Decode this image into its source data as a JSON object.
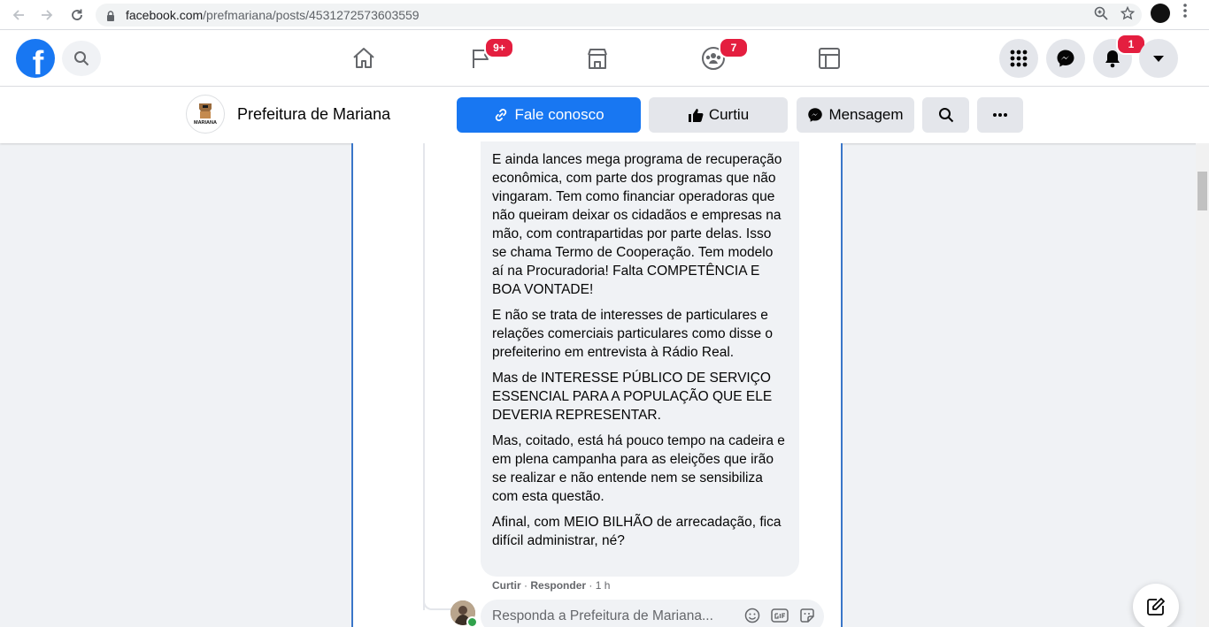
{
  "browser": {
    "url_host": "facebook.com",
    "url_path": "/prefmariana/posts/4531272573603559"
  },
  "fb_nav": {
    "logo_letter": "f",
    "pages_badge": "9+",
    "groups_badge": "7",
    "notifications_badge": "1"
  },
  "page_header": {
    "avatar_text": "MARIANA",
    "page_name": "Prefeitura de Mariana",
    "contact_label": "Fale conosco",
    "liked_label": "Curtiu",
    "message_label": "Mensagem"
  },
  "comment": {
    "paragraphs": [
      "E ainda lances mega programa de recuperação econômica, com parte dos programas que não vingaram. Tem como financiar operadoras que não queiram deixar os cidadãos e empresas na mão, com contrapartidas por parte delas. Isso se chama Termo de Cooperação. Tem modelo aí na Procuradoria! Falta COMPETÊNCIA E BOA VONTADE!",
      "E não se trata de interesses de particulares e relações comerciais particulares como disse o prefeiterino em entrevista à Rádio Real.",
      "Mas de INTERESSE PÚBLICO DE SERVIÇO ESSENCIAL PARA A POPULAÇÃO QUE ELE DEVERIA REPRESENTAR.",
      "Mas, coitado, está há pouco tempo na cadeira e em plena campanha para as eleições que irão se realizar e não entende nem se sensibiliza com esta questão.",
      "Afinal, com MEIO BILHÃO de arrecadação, fica difícil administrar, né?"
    ],
    "like_action": "Curtir",
    "separator": "·",
    "reply_action": "Responder",
    "time": "1 h"
  },
  "reply": {
    "placeholder": "Responda a Prefeitura de Mariana..."
  },
  "colors": {
    "fb_blue": "#1877f2",
    "badge_red": "#e41e3f",
    "frame_border": "#3a76c9"
  }
}
